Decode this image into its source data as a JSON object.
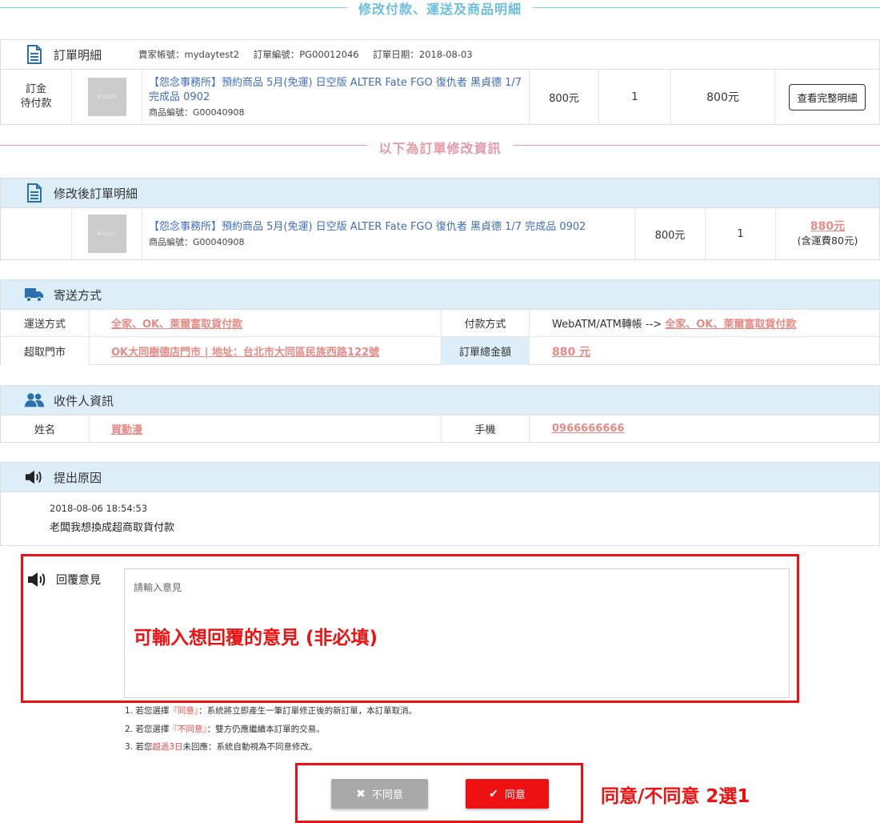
{
  "dividers": {
    "top": "修改付款、運送及商品明細",
    "mid": "以下為訂單修改資訊"
  },
  "order": {
    "title": "訂單明細",
    "seller": "賣家帳號：mydaytest2",
    "order_no": "訂單編號：PG00012046",
    "order_date": "訂單日期：2018-08-03",
    "status_line1": "訂金",
    "status_line2": "待付款",
    "thumb_text": "MYACG",
    "product_name": "【怨念事務所】預約商品 5月(免運) 日空版 ALTER Fate FGO 復仇者 黑貞德 1/7 完成品 0902",
    "product_code": "商品編號：G00040908",
    "price": "800元",
    "qty": "1",
    "subtotal": "800元",
    "detail_button": "查看完整明細"
  },
  "modified": {
    "title": "修改後訂單明細",
    "thumb_text": "MYACG",
    "product_name": "【怨念事務所】預約商品 5月(免運) 日空版 ALTER Fate FGO 復仇者 黑貞德 1/7 完成品 0902",
    "product_code": "商品編號：G00040908",
    "price": "800元",
    "qty": "1",
    "total": "880元",
    "total_note": "(含運費80元)"
  },
  "shipping": {
    "title": "寄送方式",
    "ship_label": "運送方式",
    "ship_value": "全家、OK、萊爾富取貨付款",
    "pay_label": "付款方式",
    "pay_prefix": "WebATM/ATM轉帳 -->",
    "pay_value": "全家、OK、萊爾富取貨付款",
    "store_label": "超取門市",
    "store_value": "OK大同樹德店門市 | 地址：台北市大同區民族西路122號",
    "total_label": "訂單總金額",
    "total_value": "880 元"
  },
  "recipient": {
    "title": "收件人資訊",
    "name_label": "姓名",
    "name_value": "買動漫",
    "phone_label": "手機",
    "phone_value": "0966666666"
  },
  "reason": {
    "title": "提出原因",
    "timestamp": "2018-08-06 18:54:53",
    "message": "老闆我想換成超商取貨付款"
  },
  "reply": {
    "label": "回覆意見",
    "placeholder": "請輸入意見",
    "annotation": "可輸入想回覆的意見 (非必填)"
  },
  "notes": {
    "n1_a": "1. 若您選擇",
    "n1_b": "『同意』",
    "n1_c": "：系統將立即產生一筆訂單修正後的新訂單，本訂單取消。",
    "n2_a": "2. 若您選擇",
    "n2_b": "『不同意』",
    "n2_c": "：雙方仍應繼續本訂單的交易。",
    "n3_a": "3. 若您",
    "n3_b": "超過3日",
    "n3_c": "未回應：系統自動視為不同意修改。"
  },
  "actions": {
    "disagree": "不同意",
    "agree": "同意",
    "annotation": "同意/不同意 2選1"
  },
  "colors": {
    "accent_blue": "#6bbfdc",
    "header_bg": "#ddeef9",
    "link_red": "#e88a86",
    "alert_red": "#ee1111"
  }
}
